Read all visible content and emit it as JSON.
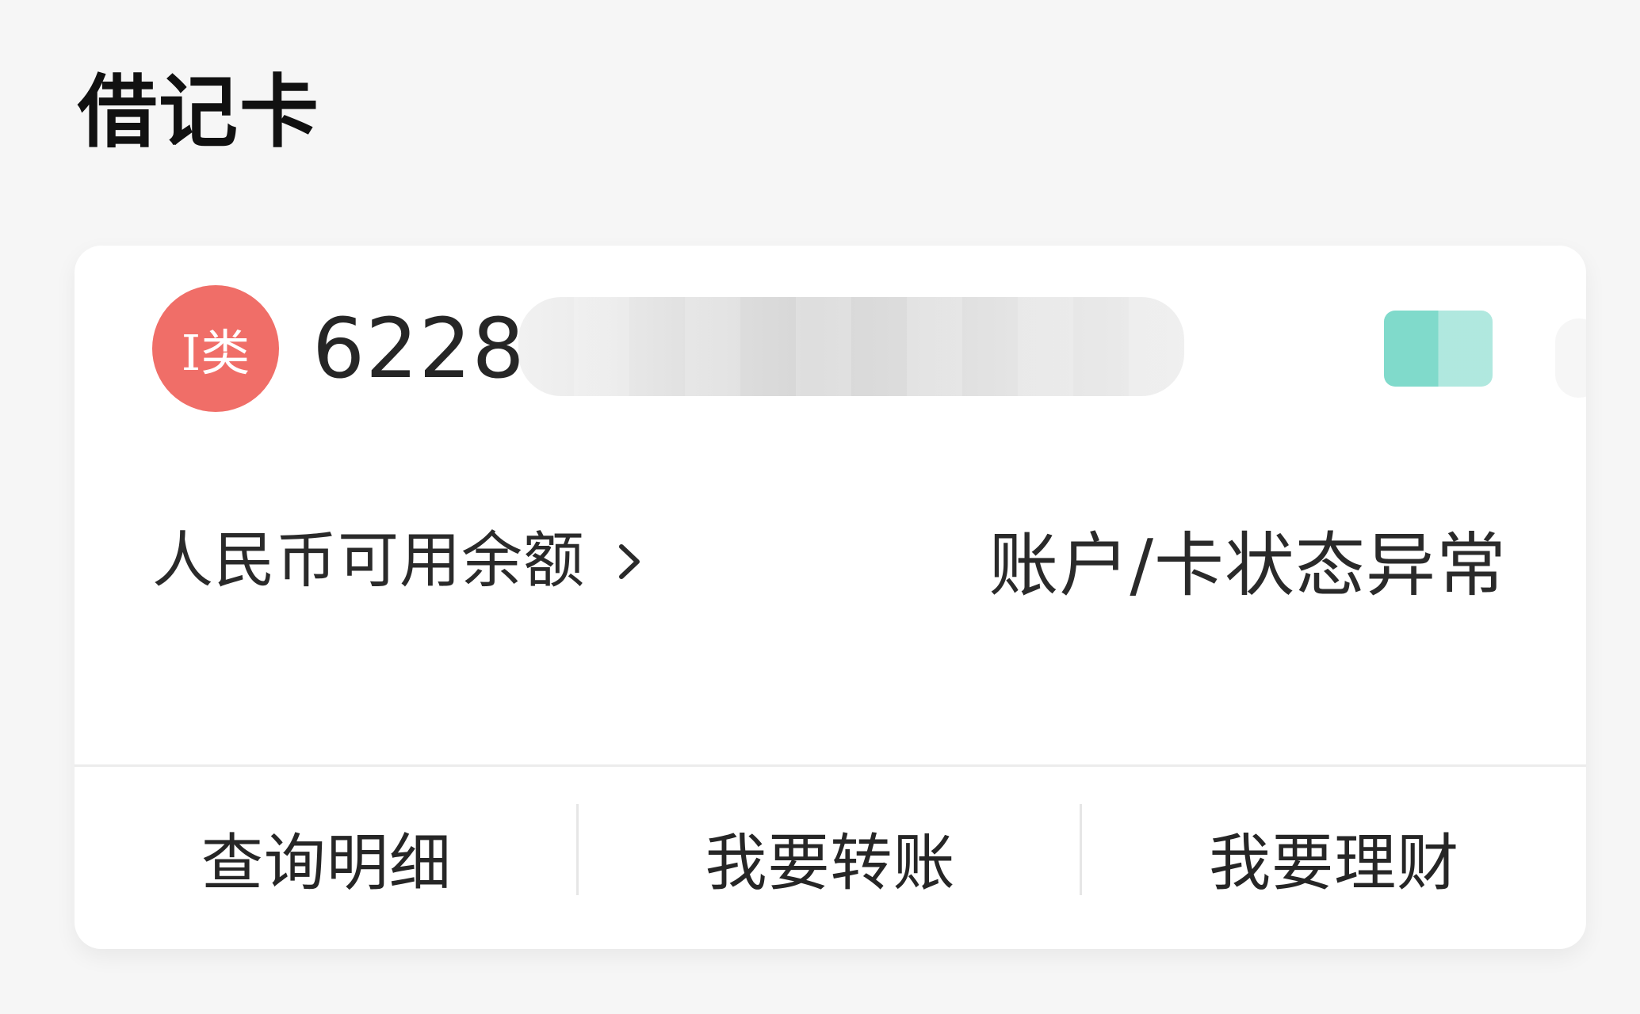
{
  "page": {
    "title": "借记卡"
  },
  "card": {
    "badge_text": "I类",
    "number_prefix": "6228",
    "balance_label": "人民币可用余额",
    "status_text": "账户/卡状态异常",
    "actions": [
      {
        "label": "查询明细"
      },
      {
        "label": "我要转账"
      },
      {
        "label": "我要理财"
      }
    ]
  },
  "colors": {
    "background": "#f6f6f6",
    "card_background": "#ffffff",
    "badge_red": "#f06e68",
    "redaction_teal": "#79d8c8",
    "divider": "#ececec"
  },
  "icons": {
    "chevron": "chevron-right-icon"
  }
}
